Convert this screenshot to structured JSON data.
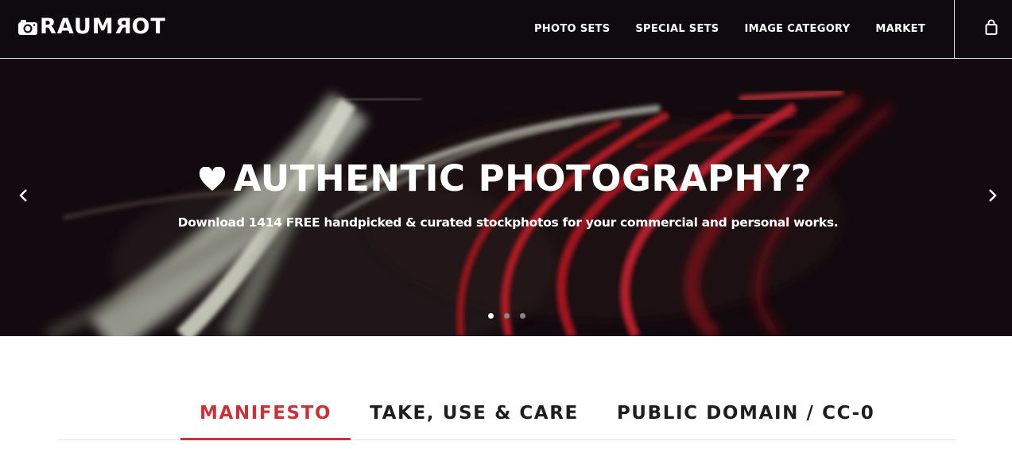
{
  "brand": {
    "name_left": "RAUM",
    "name_flipped": "R",
    "name_right": "OT",
    "icon": "camera-icon"
  },
  "nav": {
    "items": [
      {
        "label": "PHOTO SETS"
      },
      {
        "label": "SPECIAL SETS"
      },
      {
        "label": "IMAGE CATEGORY"
      },
      {
        "label": "MARKET"
      }
    ],
    "cart_icon": "shopping-bag-icon"
  },
  "hero": {
    "title": "AUTHENTIC PHOTOGRAPHY?",
    "title_icon": "heart-icon",
    "subtitle": "Download 1414 FREE handpicked & curated stockphotos for your commercial and personal works.",
    "prev_icon": "chevron-left-icon",
    "next_icon": "chevron-right-icon",
    "slides_total": 3,
    "active_slide": 1
  },
  "tabs": [
    {
      "label": "MANIFESTO",
      "active": true
    },
    {
      "label": "TAKE, USE & CARE",
      "active": false
    },
    {
      "label": "PUBLIC DOMAIN / CC-0",
      "active": false
    }
  ],
  "colors": {
    "accent": "#c8323a",
    "header_bg": "#0f0a0d",
    "text_dark": "#1e1e1e"
  }
}
